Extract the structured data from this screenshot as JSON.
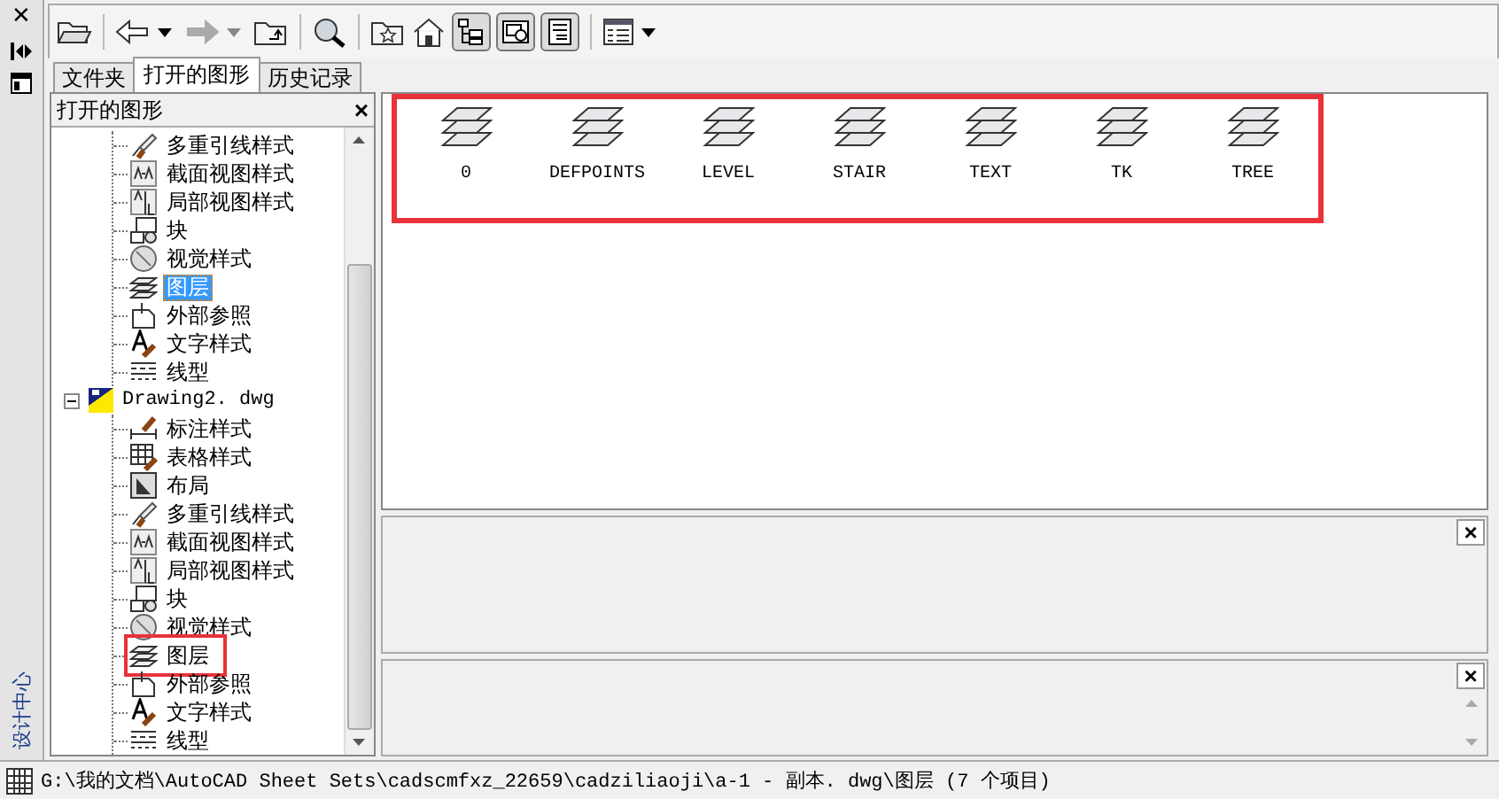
{
  "side_strip": {
    "close": "✕",
    "title": "设计中心"
  },
  "toolbar": {
    "back": {
      "disabled": false
    },
    "forward": {
      "disabled": true
    },
    "toggles": [
      {
        "pressed": true
      },
      {
        "pressed": true
      },
      {
        "pressed": true
      }
    ]
  },
  "tabs": [
    {
      "label": "文件夹",
      "selected": false
    },
    {
      "label": "打开的图形",
      "selected": true
    },
    {
      "label": "历史记录",
      "selected": false
    }
  ],
  "tree_panel": {
    "title": "打开的图形",
    "close": "×"
  },
  "tree": [
    {
      "children": [
        {
          "label": "多重引线样式",
          "kind": "multileader",
          "selected": false,
          "highlighted": false
        },
        {
          "label": "截面视图样式",
          "kind": "section",
          "selected": false,
          "highlighted": false
        },
        {
          "label": "局部视图样式",
          "kind": "detail",
          "selected": false,
          "highlighted": false
        },
        {
          "label": "块",
          "kind": "block",
          "selected": false,
          "highlighted": false
        },
        {
          "label": "视觉样式",
          "kind": "visual",
          "selected": false,
          "highlighted": false
        },
        {
          "label": "图层",
          "kind": "layer",
          "selected": true,
          "highlighted": false
        },
        {
          "label": "外部参照",
          "kind": "xref",
          "selected": false,
          "highlighted": false
        },
        {
          "label": "文字样式",
          "kind": "textstyle",
          "selected": false,
          "highlighted": false
        },
        {
          "label": "线型",
          "kind": "linetype",
          "selected": false,
          "highlighted": false
        }
      ]
    },
    {
      "label": "Drawing2. dwg",
      "expanded": true,
      "children": [
        {
          "label": "标注样式",
          "kind": "dimstyle",
          "selected": false,
          "highlighted": false
        },
        {
          "label": "表格样式",
          "kind": "tablestyle",
          "selected": false,
          "highlighted": false
        },
        {
          "label": "布局",
          "kind": "layout",
          "selected": false,
          "highlighted": false
        },
        {
          "label": "多重引线样式",
          "kind": "multileader",
          "selected": false,
          "highlighted": false
        },
        {
          "label": "截面视图样式",
          "kind": "section",
          "selected": false,
          "highlighted": false
        },
        {
          "label": "局部视图样式",
          "kind": "detail",
          "selected": false,
          "highlighted": false
        },
        {
          "label": "块",
          "kind": "block",
          "selected": false,
          "highlighted": false
        },
        {
          "label": "视觉样式",
          "kind": "visual",
          "selected": false,
          "highlighted": false
        },
        {
          "label": "图层",
          "kind": "layer",
          "selected": false,
          "highlighted": true
        },
        {
          "label": "外部参照",
          "kind": "xref",
          "selected": false,
          "highlighted": false
        },
        {
          "label": "文字样式",
          "kind": "textstyle",
          "selected": false,
          "highlighted": false
        },
        {
          "label": "线型",
          "kind": "linetype",
          "selected": false,
          "highlighted": false
        }
      ]
    }
  ],
  "content": {
    "highlighted": true,
    "layers": [
      {
        "name": "0"
      },
      {
        "name": "DEFPOINTS"
      },
      {
        "name": "LEVEL"
      },
      {
        "name": "STAIR"
      },
      {
        "name": "TEXT"
      },
      {
        "name": "TK"
      },
      {
        "name": "TREE"
      }
    ]
  },
  "preview_pane": {
    "close": "×"
  },
  "description_pane": {
    "close": "×"
  },
  "status_bar": {
    "path": "G:\\我的文档\\AutoCAD Sheet Sets\\cadscmfxz_22659\\cadziliaoji\\a-1 - 副本. dwg\\图层 (7 个项目)"
  }
}
